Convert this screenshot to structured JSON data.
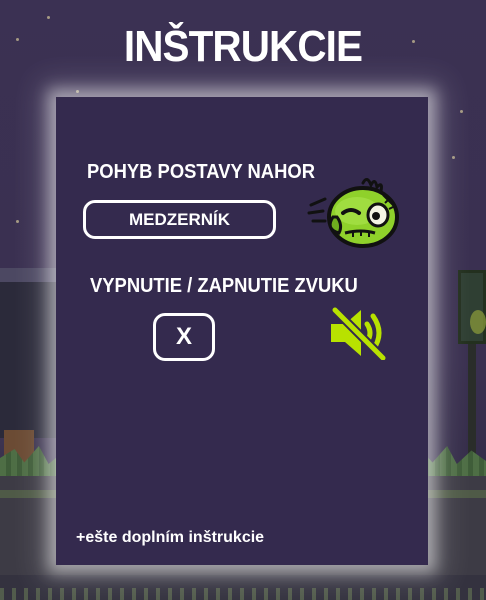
{
  "title": "INŠTRUKCIE",
  "instructions": {
    "move_up": {
      "label": "POHYB POSTAVY NAHOR",
      "key": "MEDZERNÍK",
      "icon": "zombie-bird-icon"
    },
    "toggle_sound": {
      "label": "VYPNUTIE / ZAPNUTIE ZVUKU",
      "key": "X",
      "icon": "speaker-muted-icon"
    }
  },
  "footer_note": "+ešte doplním inštrukcie",
  "colors": {
    "panel": "#342a4e",
    "background": "#3a3050",
    "accent_green": "#b8e200",
    "character_green": "#8fd12b",
    "text": "#ffffff"
  }
}
